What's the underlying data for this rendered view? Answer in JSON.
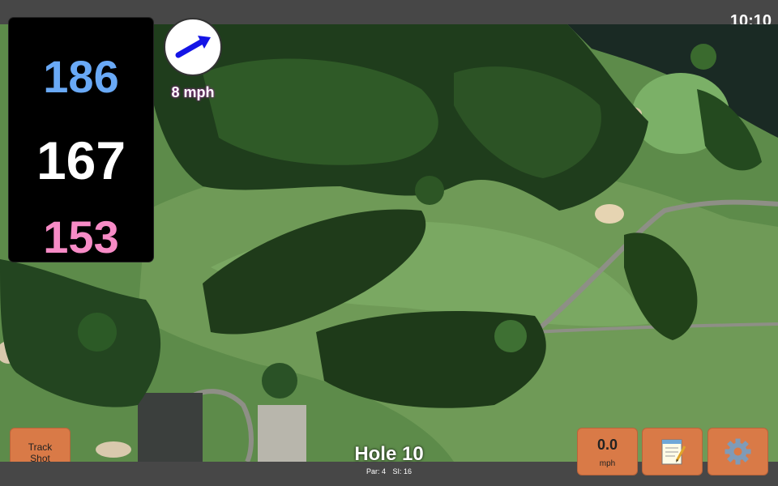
{
  "status": {
    "time": "10:10"
  },
  "distances": {
    "back": "186",
    "middle": "167",
    "front": "153"
  },
  "wind": {
    "speed_text": "8 mph",
    "direction_icon": "arrow-icon"
  },
  "buttons": {
    "track_shot_line1": "Track",
    "track_shot_line2": "Shot",
    "speed_value": "0.0",
    "speed_unit": "mph",
    "notes_icon": "notepad-icon",
    "settings_icon": "gear-icon"
  },
  "hole": {
    "title": "Hole 10",
    "par": "Par: 4",
    "si": "SI: 16"
  },
  "colors": {
    "back": "#69a9f6",
    "middle": "#ffffff",
    "front": "#f78bc6",
    "button": "#d97a47"
  }
}
